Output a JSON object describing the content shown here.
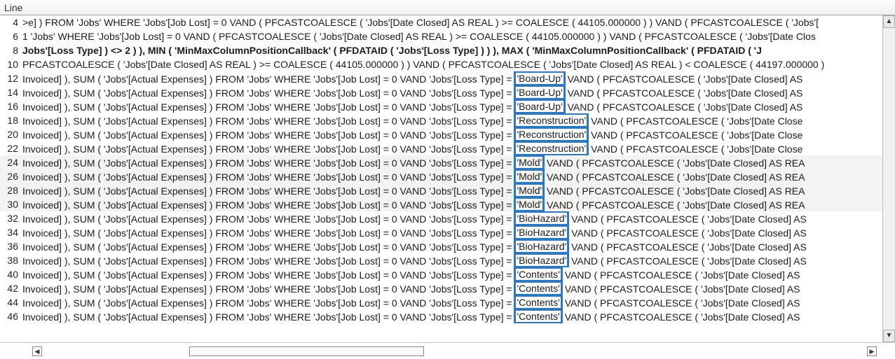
{
  "header": {
    "title": "Line"
  },
  "highlight_color": "#2b78c4",
  "rows": [
    {
      "line": 4,
      "bold": false,
      "alt": false,
      "left": ">e] ) FROM 'Jobs' WHERE 'Jobs'[Job Lost] = 0 VAND  ( PFCASTCOALESCE ( 'Jobs'[Date Closed] AS  REAL ) >= COALESCE ( 44105.000000 )  ) VAND  ( PFCASTCOALESCE ( 'Jobs'[",
      "term": null,
      "right": ""
    },
    {
      "line": 6,
      "bold": false,
      "alt": false,
      "left": "1 'Jobs' WHERE 'Jobs'[Job Lost] = 0 VAND  ( PFCASTCOALESCE ( 'Jobs'[Date Closed] AS  REAL ) >= COALESCE ( 44105.000000 )  ) VAND  ( PFCASTCOALESCE ( 'Jobs'[Date Clos",
      "term": null,
      "right": ""
    },
    {
      "line": 8,
      "bold": true,
      "alt": false,
      "left": "Jobs'[Loss Type] ) <> 2 )  ), MIN ( 'MinMaxColumnPositionCallback' ( PFDATAID ( 'Jobs'[Loss Type] )  )  ), MAX ( 'MinMaxColumnPositionCallback' ( PFDATAID ( 'J",
      "term": null,
      "right": ""
    },
    {
      "line": 10,
      "bold": false,
      "alt": false,
      "left": "  PFCASTCOALESCE ( 'Jobs'[Date Closed] AS  REAL ) >= COALESCE ( 44105.000000 )  ) VAND  ( PFCASTCOALESCE ( 'Jobs'[Date Closed] AS  REAL ) < COALESCE ( 44197.000000 )",
      "term": null,
      "right": ""
    },
    {
      "line": 12,
      "bold": false,
      "alt": false,
      "left": "Invoiced] ), SUM ( 'Jobs'[Actual Expenses] ) FROM 'Jobs' WHERE 'Jobs'[Job Lost] = 0 VAND 'Jobs'[Loss Type] = ",
      "term": "'Board-Up'",
      "right": " VAND  ( PFCASTCOALESCE ( 'Jobs'[Date Closed] AS"
    },
    {
      "line": 14,
      "bold": false,
      "alt": false,
      "left": "Invoiced] ), SUM ( 'Jobs'[Actual Expenses] ) FROM 'Jobs' WHERE 'Jobs'[Job Lost] = 0 VAND 'Jobs'[Loss Type] = ",
      "term": "'Board-Up'",
      "right": " VAND  ( PFCASTCOALESCE ( 'Jobs'[Date Closed] AS"
    },
    {
      "line": 16,
      "bold": false,
      "alt": false,
      "left": "Invoiced] ), SUM ( 'Jobs'[Actual Expenses] ) FROM 'Jobs' WHERE 'Jobs'[Job Lost] = 0 VAND 'Jobs'[Loss Type] = ",
      "term": "'Board-Up'",
      "right": " VAND  ( PFCASTCOALESCE ( 'Jobs'[Date Closed] AS"
    },
    {
      "line": 18,
      "bold": false,
      "alt": false,
      "left": "Invoiced] ), SUM ( 'Jobs'[Actual Expenses] ) FROM 'Jobs' WHERE 'Jobs'[Job Lost] = 0 VAND 'Jobs'[Loss Type] = ",
      "term": "'Reconstruction'",
      "right": " VAND  ( PFCASTCOALESCE ( 'Jobs'[Date Close"
    },
    {
      "line": 20,
      "bold": false,
      "alt": false,
      "left": "Invoiced] ), SUM ( 'Jobs'[Actual Expenses] ) FROM 'Jobs' WHERE 'Jobs'[Job Lost] = 0 VAND 'Jobs'[Loss Type] = ",
      "term": "'Reconstruction'",
      "right": " VAND  ( PFCASTCOALESCE ( 'Jobs'[Date Close"
    },
    {
      "line": 22,
      "bold": false,
      "alt": false,
      "left": "Invoiced] ), SUM ( 'Jobs'[Actual Expenses] ) FROM 'Jobs' WHERE 'Jobs'[Job Lost] = 0 VAND 'Jobs'[Loss Type] = ",
      "term": "'Reconstruction'",
      "right": " VAND  ( PFCASTCOALESCE ( 'Jobs'[Date Close"
    },
    {
      "line": 24,
      "bold": false,
      "alt": true,
      "left": "Invoiced] ), SUM ( 'Jobs'[Actual Expenses] ) FROM 'Jobs' WHERE 'Jobs'[Job Lost] = 0 VAND 'Jobs'[Loss Type] = ",
      "term": "'Mold'",
      "right": " VAND  ( PFCASTCOALESCE ( 'Jobs'[Date Closed] AS  REA"
    },
    {
      "line": 26,
      "bold": false,
      "alt": true,
      "left": "Invoiced] ), SUM ( 'Jobs'[Actual Expenses] ) FROM 'Jobs' WHERE 'Jobs'[Job Lost] = 0 VAND 'Jobs'[Loss Type] = ",
      "term": "'Mold'",
      "right": " VAND  ( PFCASTCOALESCE ( 'Jobs'[Date Closed] AS  REA"
    },
    {
      "line": 28,
      "bold": false,
      "alt": true,
      "left": "Invoiced] ), SUM ( 'Jobs'[Actual Expenses] ) FROM 'Jobs' WHERE 'Jobs'[Job Lost] = 0 VAND 'Jobs'[Loss Type] = ",
      "term": "'Mold'",
      "right": " VAND  ( PFCASTCOALESCE ( 'Jobs'[Date Closed] AS  REA"
    },
    {
      "line": 30,
      "bold": false,
      "alt": true,
      "left": "Invoiced] ), SUM ( 'Jobs'[Actual Expenses] ) FROM 'Jobs' WHERE 'Jobs'[Job Lost] = 0 VAND 'Jobs'[Loss Type] = ",
      "term": "'Mold'",
      "right": " VAND  ( PFCASTCOALESCE ( 'Jobs'[Date Closed] AS  REA"
    },
    {
      "line": 32,
      "bold": false,
      "alt": false,
      "left": "Invoiced] ), SUM ( 'Jobs'[Actual Expenses] ) FROM 'Jobs' WHERE 'Jobs'[Job Lost] = 0 VAND 'Jobs'[Loss Type] = ",
      "term": "'BioHazard'",
      "right": " VAND  ( PFCASTCOALESCE ( 'Jobs'[Date Closed] AS"
    },
    {
      "line": 34,
      "bold": false,
      "alt": false,
      "left": "Invoiced] ), SUM ( 'Jobs'[Actual Expenses] ) FROM 'Jobs' WHERE 'Jobs'[Job Lost] = 0 VAND 'Jobs'[Loss Type] = ",
      "term": "'BioHazard'",
      "right": " VAND  ( PFCASTCOALESCE ( 'Jobs'[Date Closed] AS"
    },
    {
      "line": 36,
      "bold": false,
      "alt": false,
      "left": "Invoiced] ), SUM ( 'Jobs'[Actual Expenses] ) FROM 'Jobs' WHERE 'Jobs'[Job Lost] = 0 VAND 'Jobs'[Loss Type] = ",
      "term": "'BioHazard'",
      "right": " VAND  ( PFCASTCOALESCE ( 'Jobs'[Date Closed] AS"
    },
    {
      "line": 38,
      "bold": false,
      "alt": false,
      "left": "Invoiced] ), SUM ( 'Jobs'[Actual Expenses] ) FROM 'Jobs' WHERE 'Jobs'[Job Lost] = 0 VAND 'Jobs'[Loss Type] = ",
      "term": "'BioHazard'",
      "right": " VAND  ( PFCASTCOALESCE ( 'Jobs'[Date Closed] AS"
    },
    {
      "line": 40,
      "bold": false,
      "alt": false,
      "left": "Invoiced] ), SUM ( 'Jobs'[Actual Expenses] ) FROM 'Jobs' WHERE 'Jobs'[Job Lost] = 0 VAND 'Jobs'[Loss Type] = ",
      "term": "'Contents'",
      "right": " VAND  ( PFCASTCOALESCE ( 'Jobs'[Date Closed] AS"
    },
    {
      "line": 42,
      "bold": false,
      "alt": false,
      "left": "Invoiced] ), SUM ( 'Jobs'[Actual Expenses] ) FROM 'Jobs' WHERE 'Jobs'[Job Lost] = 0 VAND 'Jobs'[Loss Type] = ",
      "term": "'Contents'",
      "right": " VAND  ( PFCASTCOALESCE ( 'Jobs'[Date Closed] AS"
    },
    {
      "line": 44,
      "bold": false,
      "alt": false,
      "left": "Invoiced] ), SUM ( 'Jobs'[Actual Expenses] ) FROM 'Jobs' WHERE 'Jobs'[Job Lost] = 0 VAND 'Jobs'[Loss Type] = ",
      "term": "'Contents'",
      "right": " VAND  ( PFCASTCOALESCE ( 'Jobs'[Date Closed] AS"
    },
    {
      "line": 46,
      "bold": false,
      "alt": false,
      "left": "Invoiced] ), SUM ( 'Jobs'[Actual Expenses] ) FROM 'Jobs' WHERE 'Jobs'[Job Lost] = 0 VAND 'Jobs'[Loss Type] = ",
      "term": "'Contents'",
      "right": " VAND  ( PFCASTCOALESCE ( 'Jobs'[Date Closed] AS"
    }
  ],
  "scroll": {
    "up": "▲",
    "down": "▼",
    "left": "◀",
    "right": "▶"
  }
}
